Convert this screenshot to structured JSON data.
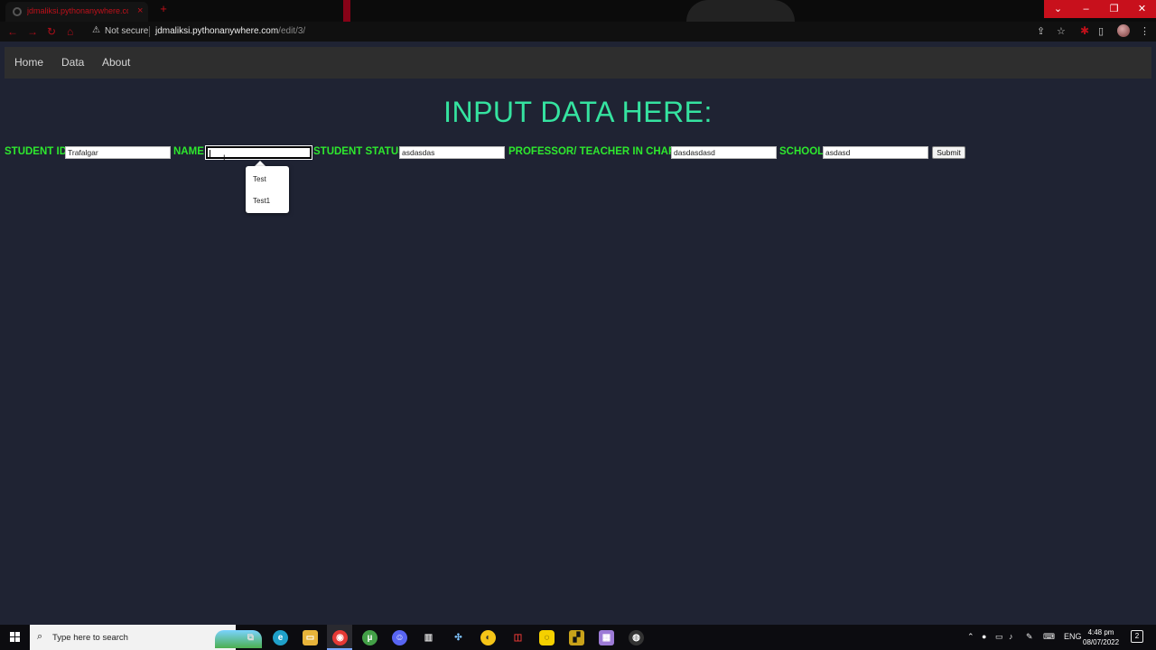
{
  "browser": {
    "tab_title": "jdmaliksi.pythonanywhere.com/",
    "tab_close": "×",
    "new_tab": "+",
    "security_label": "Not secure",
    "url_host": "jdmaliksi.pythonanywhere.com",
    "url_path": "/edit/3/",
    "window_controls": {
      "collapse": "⌄",
      "minimize": "–",
      "restore": "❐",
      "close": "✕"
    },
    "accent_color": "#c8101c"
  },
  "nav": {
    "home": "Home",
    "data": "Data",
    "about": "About"
  },
  "page": {
    "heading": "INPUT DATA HERE:",
    "heading_color": "#35e3a0",
    "label_color": "#2ee82e",
    "background_color": "#1f2333"
  },
  "form": {
    "student_id": {
      "label": "STUDENT ID:",
      "value": "Trafalgar"
    },
    "name": {
      "label": "NAME:",
      "value": ""
    },
    "student_status": {
      "label": "STUDENT STATUS:",
      "value": "asdasdas"
    },
    "professor": {
      "label": "PROFESSOR/ TEACHER IN CHARGE:",
      "value": "dasdasdasd"
    },
    "school": {
      "label": "SCHOOL:",
      "value": "asdasd"
    },
    "submit_label": "Submit"
  },
  "autocomplete": {
    "options": [
      "Test",
      "Test1"
    ]
  },
  "taskbar": {
    "search_placeholder": "Type here to search",
    "language": "ENG",
    "time": "4:48 pm",
    "date": "08/07/2022",
    "notification_count": "2"
  }
}
